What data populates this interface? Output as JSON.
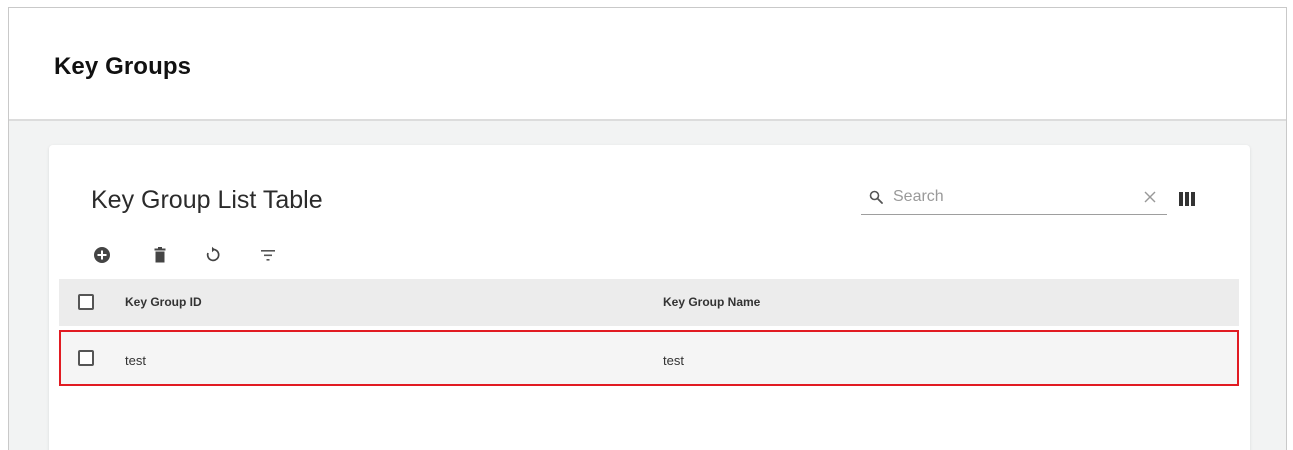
{
  "page": {
    "title": "Key Groups"
  },
  "table_card": {
    "title": "Key Group List Table",
    "search": {
      "placeholder": "Search",
      "value": "",
      "icon": "search-icon",
      "clear_icon": "close-icon"
    },
    "columns_toggle_icon": "view-column-icon",
    "toolbar": [
      {
        "icon": "add-circle-icon",
        "label": "Add"
      },
      {
        "icon": "delete-icon",
        "label": "Delete"
      },
      {
        "icon": "refresh-icon",
        "label": "Refresh"
      },
      {
        "icon": "filter-icon",
        "label": "Filter"
      }
    ],
    "columns": [
      "Key Group ID",
      "Key Group Name"
    ],
    "rows": [
      {
        "id": "test",
        "name": "test",
        "selected": false,
        "highlighted": true
      }
    ]
  },
  "colors": {
    "highlight_border": "#e11b22",
    "header_bg": "#ececec",
    "row_bg": "#f5f5f5"
  }
}
